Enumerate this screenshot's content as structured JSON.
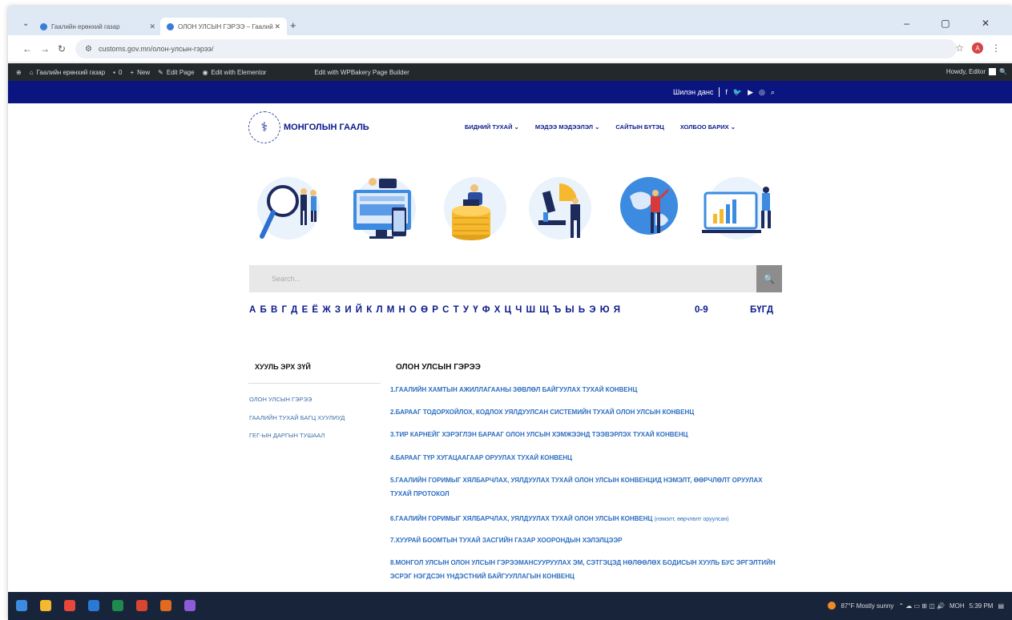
{
  "browser": {
    "tabs": [
      {
        "title": "Гаалийн ерөнхий газар"
      },
      {
        "title": "ОЛОН УЛСЫН ГЭРЭЭ – Гаалий"
      }
    ],
    "new_tab": "+",
    "window_controls": "–  ▢  ✕",
    "url": "customs.gov.mn/олон-улсын-гэрээ/",
    "profile_initial": "A"
  },
  "adminbar": {
    "items": [
      "Гаалийн ерөнхий газар",
      "0",
      "New",
      "Edit Page",
      "Edit with Elementor",
      "Edit with WPBakery Page Builder"
    ],
    "howdy": "Howdy, Editor"
  },
  "topbar": {
    "link": "Шилэн данс"
  },
  "header": {
    "logo_text": "МОНГОЛЫН ГААЛЬ",
    "nav": [
      "БИДНИЙ ТУХАЙ  ⌄",
      "МЭДЭЭ МЭДЭЭЛЭЛ  ⌄",
      "САЙТЫН БҮТЭЦ",
      "ХОЛБОО БАРИХ  ⌄"
    ]
  },
  "search": {
    "placeholder": "Search..."
  },
  "alphabet": {
    "letters": [
      "А",
      "Б",
      "В",
      "Г",
      "Д",
      "Е",
      "Ё",
      "Ж",
      "З",
      "И",
      "Й",
      "К",
      "Л",
      "М",
      "Н",
      "О",
      "Ө",
      "Р",
      "С",
      "Т",
      "У",
      "Ү",
      "Ф",
      "Х",
      "Ц",
      "Ч",
      "Ш",
      "Щ",
      "Ъ",
      "Ы",
      "Ь",
      "Э",
      "Ю",
      "Я"
    ],
    "digits": "0-9",
    "all": "БҮГД"
  },
  "sidebar": {
    "title": "ХУУЛЬ ЭРХ ЗҮЙ",
    "links": [
      "ОЛОН УЛСЫН ГЭРЭЭ",
      "ГААЛИЙН ТУХАЙ БАГЦ ХУУЛИУД",
      "ГЕГ-ЫН ДАРГЫН ТУШААЛ"
    ]
  },
  "main": {
    "title": "ОЛОН УЛСЫН ГЭРЭЭ",
    "conventions": [
      "1.ГААЛИЙН ХАМТЫН АЖИЛЛАГААНЫ ЗӨВЛӨЛ БАЙГУУЛАХ ТУХАЙ КОНВЕНЦ",
      "2.БАРААГ ТОДОРХОЙЛОХ, КОДЛОХ УЯЛДУУЛСАН СИСТЕМИЙН ТУХАЙ ОЛОН УЛСЫН КОНВЕНЦ",
      "3.ТИР КАРНЕЙГ ХЭРЭГЛЭН БАРААГ ОЛОН УЛСЫН ХЭМЖЭЭНД ТЭЭВЭРЛЭХ ТУХАЙ КОНВЕНЦ",
      "4.БАРААГ ТҮР ХУГАЦААГААР ОРУУЛАХ ТУХАЙ КОНВЕНЦ",
      "5.ГААЛИЙН ГОРИМЫГ ХЯЛБАРЧЛАХ, УЯЛДУУЛАХ ТУХАЙ ОЛОН УЛСЫН КОНВЕНЦИД НЭМЭЛТ, ӨӨРЧЛӨЛТ ОРУУЛАХ ТУХАЙ ПРОТОКОЛ",
      "6.ГААЛИЙН ГОРИМЫГ ХЯЛБАРЧЛАХ, УЯЛДУУЛАХ ТУХАЙ ОЛОН УЛСЫН КОНВЕНЦ",
      "7.ХУУРАЙ БООМТЫН ТУХАЙ ЗАСГИЙН ГАЗАР ХООРОНДЫН ХЭЛЭЛЦЭЭР",
      "8.МОНГОЛ УЛСЫН ОЛОН УЛСЫН ГЭРЭЭМАНСУУРУУЛАХ ЭМ, СЭТГЭЦЭД НӨЛӨӨЛӨХ БОДИСЫН ХУУЛЬ БУС ЭРГЭЛТИЙН ЭСРЭГ НЭГДСЭН ҮНДЭСТНИЙ БАЙГУУЛЛАГЫН КОНВЕНЦ"
    ],
    "convention_6_note": "(нэмэлт, өөрчлөлт оруулсан)"
  },
  "taskbar": {
    "weather": "87°F  Mostly sunny",
    "lang": "МОН",
    "time": "5:39 PM"
  },
  "colors": {
    "navy": "#0b1580",
    "link": "#2d6ec1",
    "adminbar": "#23282d",
    "taskbar": "#17243a"
  }
}
